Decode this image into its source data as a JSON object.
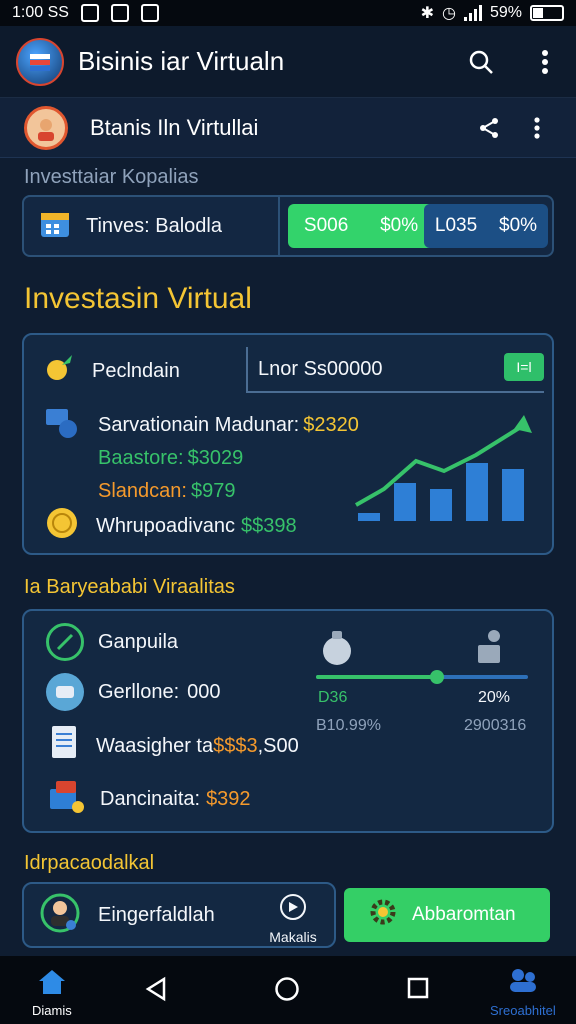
{
  "status_bar": {
    "time": "1:00 SS",
    "battery": "59%"
  },
  "app_bar": {
    "title": "Bisinis iar Virtualn",
    "icons": [
      "app-logo-icon",
      "search-icon",
      "more-vert-icon"
    ]
  },
  "sub_bar": {
    "title": "Btanis Iln Virtullai",
    "icons": [
      "avatar-icon",
      "share-icon",
      "more-vert-icon"
    ]
  },
  "invest_section": {
    "label": "Investtaiar Kopalias",
    "name": "Tinves: Balodla",
    "green_pill": {
      "left": "S006",
      "right": "$0%"
    },
    "blue_pill": {
      "left": "L035",
      "right": "$0%"
    }
  },
  "main_title": "Investasin Virtual",
  "card1": {
    "row1_label": "Peclndain",
    "lnor_value": "Lnor Ss00000",
    "badge": "I=l",
    "row2_label": "Sarvationain Madunar:",
    "row2_value": "$2320",
    "row3_label": "Baastore:",
    "row3_value": "$3029",
    "row4_label": "Slandcan:",
    "row4_value": "$979",
    "row5_label": "Whrupoadivanc",
    "row5_value": "$$398",
    "colors": {
      "gold": "#f4c534",
      "green": "#37c26a",
      "orange": "#f59a2c"
    }
  },
  "section2_label": "Ia Baryeababi Viraalitas",
  "card2": {
    "row1_label": "Ganpuila",
    "row2_label": "Gerllone:",
    "row2_value": "000",
    "row3_label": "Waasigher",
    "row3_label2": "ta",
    "row3_value": "$$$3",
    "row3_suffix": ",S00",
    "row4_label": "Dancinaita:",
    "row4_value": "$392",
    "slider_fraction": 0.57,
    "left_value": "D36",
    "left_sub": "B10.99%",
    "right_value": "20%",
    "right_sub": "2900316"
  },
  "section3_label": "Idrpacaodalkal",
  "bottom": {
    "card_label": "Eingerfaldlah",
    "makalis_label": "Makalis",
    "green_button": "Abbaromtan"
  },
  "nav": {
    "home_label": "Diamis",
    "right_label": "Sreoabhitel"
  }
}
